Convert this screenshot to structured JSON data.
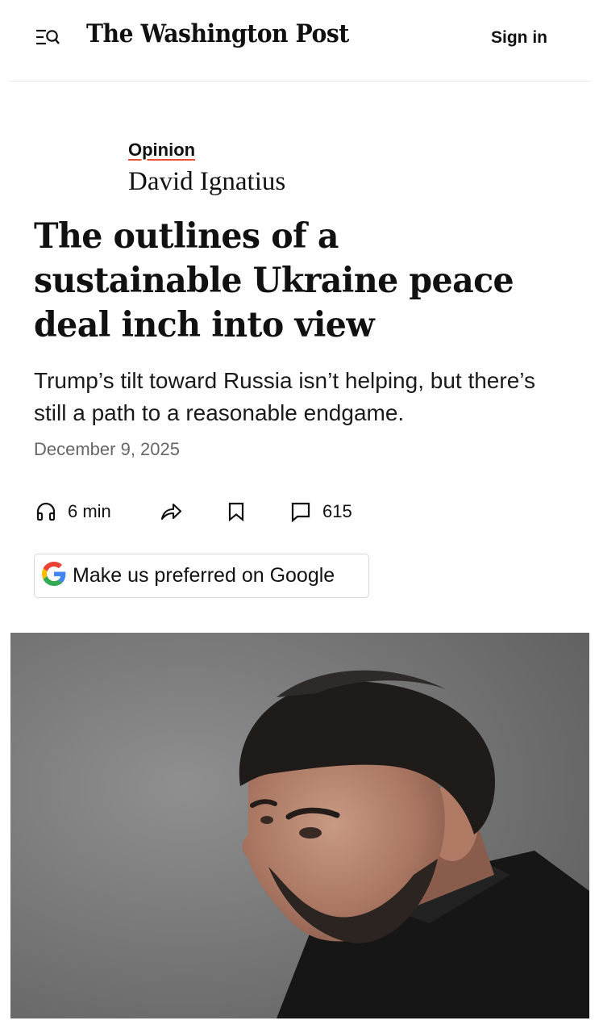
{
  "header": {
    "menu_search_icon": "menu-search-icon",
    "masthead": "The Washington Post",
    "sign_in": "Sign in"
  },
  "article": {
    "section": "Opinion",
    "author": "David Ignatius",
    "headline": "The outlines of a sustainable Ukraine peace deal inch into view",
    "subheadline": "Trump’s tilt toward Russia isn’t helping, but there’s still a path to a reasonable endgame.",
    "date": "December 9, 2025"
  },
  "actions": {
    "listen": {
      "icon": "headphones-icon",
      "label": "6 min"
    },
    "share": {
      "icon": "share-arrow-icon"
    },
    "save": {
      "icon": "bookmark-icon"
    },
    "comments": {
      "icon": "comment-icon",
      "count": "615"
    }
  },
  "google_preference": {
    "icon": "google-g-icon",
    "label": "Make us preferred on Google"
  },
  "lead_image": {
    "icon": "photo-portrait"
  },
  "colors": {
    "opinion_underline": "#e8502f",
    "text": "#111111",
    "muted": "#666666",
    "divider": "#e3e3e3",
    "google_blue": "#4285F4",
    "google_red": "#EA4335",
    "google_yellow": "#FBBC05",
    "google_green": "#34A853"
  }
}
